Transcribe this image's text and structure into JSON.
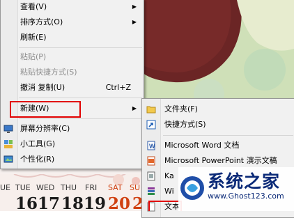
{
  "context_menu": {
    "items": [
      {
        "label": "查看(V)",
        "submenu": true
      },
      {
        "label": "排序方式(O)",
        "submenu": true
      },
      {
        "label": "刷新(E)"
      },
      {
        "label": "粘贴(P)",
        "disabled": true
      },
      {
        "label": "粘贴快捷方式(S)",
        "disabled": true
      },
      {
        "label": "撤消 复制(U)",
        "shortcut": "Ctrl+Z"
      },
      {
        "label": "新建(W)",
        "submenu": true,
        "highlighted": true
      },
      {
        "label": "屏幕分辨率(C)"
      },
      {
        "label": "小工具(G)"
      },
      {
        "label": "个性化(R)"
      }
    ]
  },
  "new_submenu": {
    "items": [
      {
        "label": "文件夹(F)",
        "icon": "folder-icon"
      },
      {
        "label": "快捷方式(S)",
        "icon": "shortcut-icon"
      },
      {
        "label": "Microsoft Word 文档",
        "icon": "word-doc-icon"
      },
      {
        "label": "Microsoft PowerPoint 演示文稿",
        "icon": "powerpoint-icon"
      },
      {
        "label": "Ka",
        "icon": "generic-app-icon"
      },
      {
        "label": "Wi",
        "icon": "winrar-icon"
      },
      {
        "label": "文本",
        "icon": "text-doc-icon"
      }
    ]
  },
  "calendar": {
    "days": [
      "UE",
      "TUE",
      "WED",
      "THU",
      "FRI",
      "SAT",
      "SU"
    ],
    "numbers": [
      "",
      "16",
      "17",
      "18",
      "19",
      "20",
      "2"
    ]
  },
  "watermark": {
    "title": "系统之家",
    "url": "www.Ghost123.com"
  },
  "colors": {
    "highlight_border": "#e10000",
    "sat_color": "#d04010",
    "sun_color": "#d04010"
  }
}
